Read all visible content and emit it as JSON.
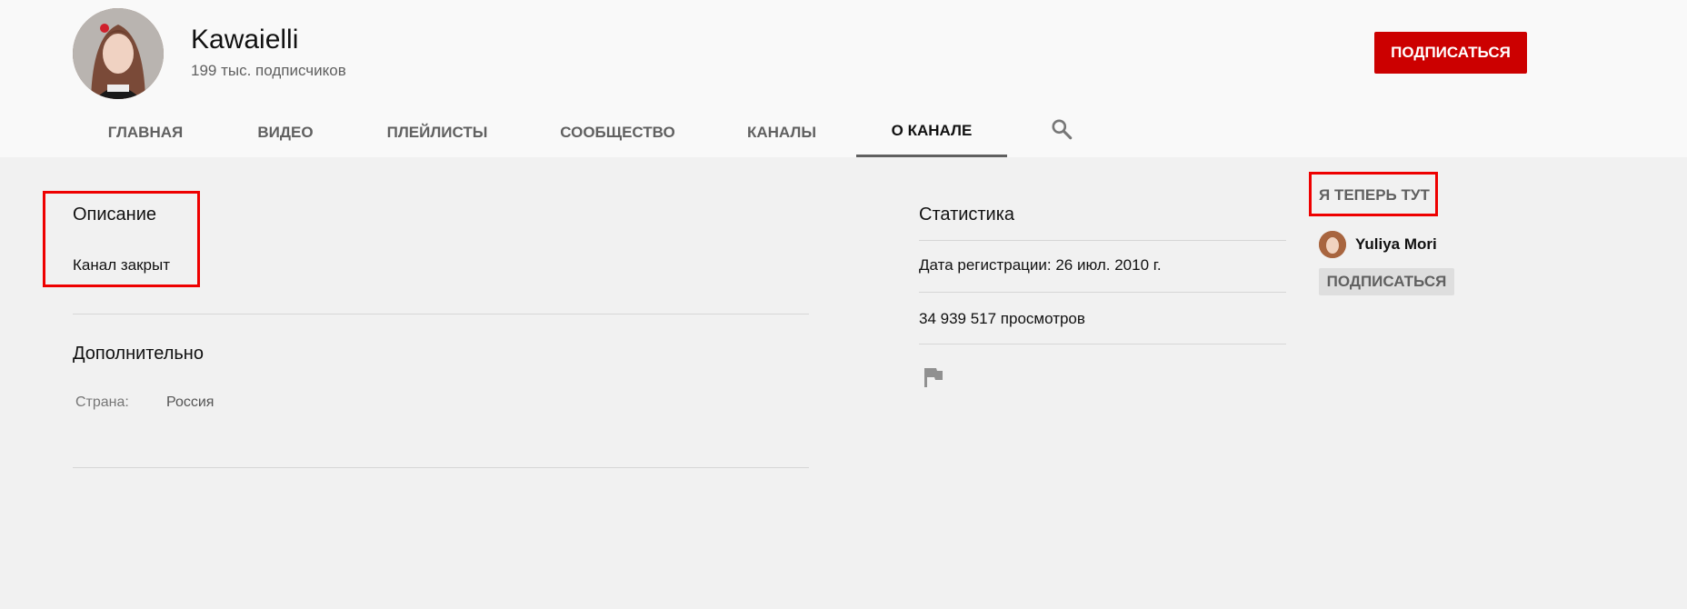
{
  "channel": {
    "name": "Kawaielli",
    "subscribers": "199 тыс. подписчиков",
    "subscribe_label": "ПОДПИСАТЬСЯ"
  },
  "tabs": [
    {
      "label": "ГЛАВНАЯ",
      "active": false
    },
    {
      "label": "ВИДЕО",
      "active": false
    },
    {
      "label": "ПЛЕЙЛИСТЫ",
      "active": false
    },
    {
      "label": "СООБЩЕСТВО",
      "active": false
    },
    {
      "label": "КАНАЛЫ",
      "active": false
    },
    {
      "label": "О КАНАЛЕ",
      "active": true
    }
  ],
  "description": {
    "title": "Описание",
    "text": "Канал закрыт"
  },
  "details": {
    "title": "Дополнительно",
    "country_label": "Страна:",
    "country_value": "Россия"
  },
  "stats": {
    "title": "Статистика",
    "joined": "Дата регистрации: 26 июл. 2010 г.",
    "views": "34 939 517 просмотров"
  },
  "featured": {
    "title": "Я ТЕПЕРЬ ТУТ",
    "channel_name": "Yuliya Mori",
    "subscribe_label": "ПОДПИСАТЬСЯ"
  },
  "colors": {
    "subscribe_red": "#cc0000",
    "highlight_red": "#ee0000"
  }
}
